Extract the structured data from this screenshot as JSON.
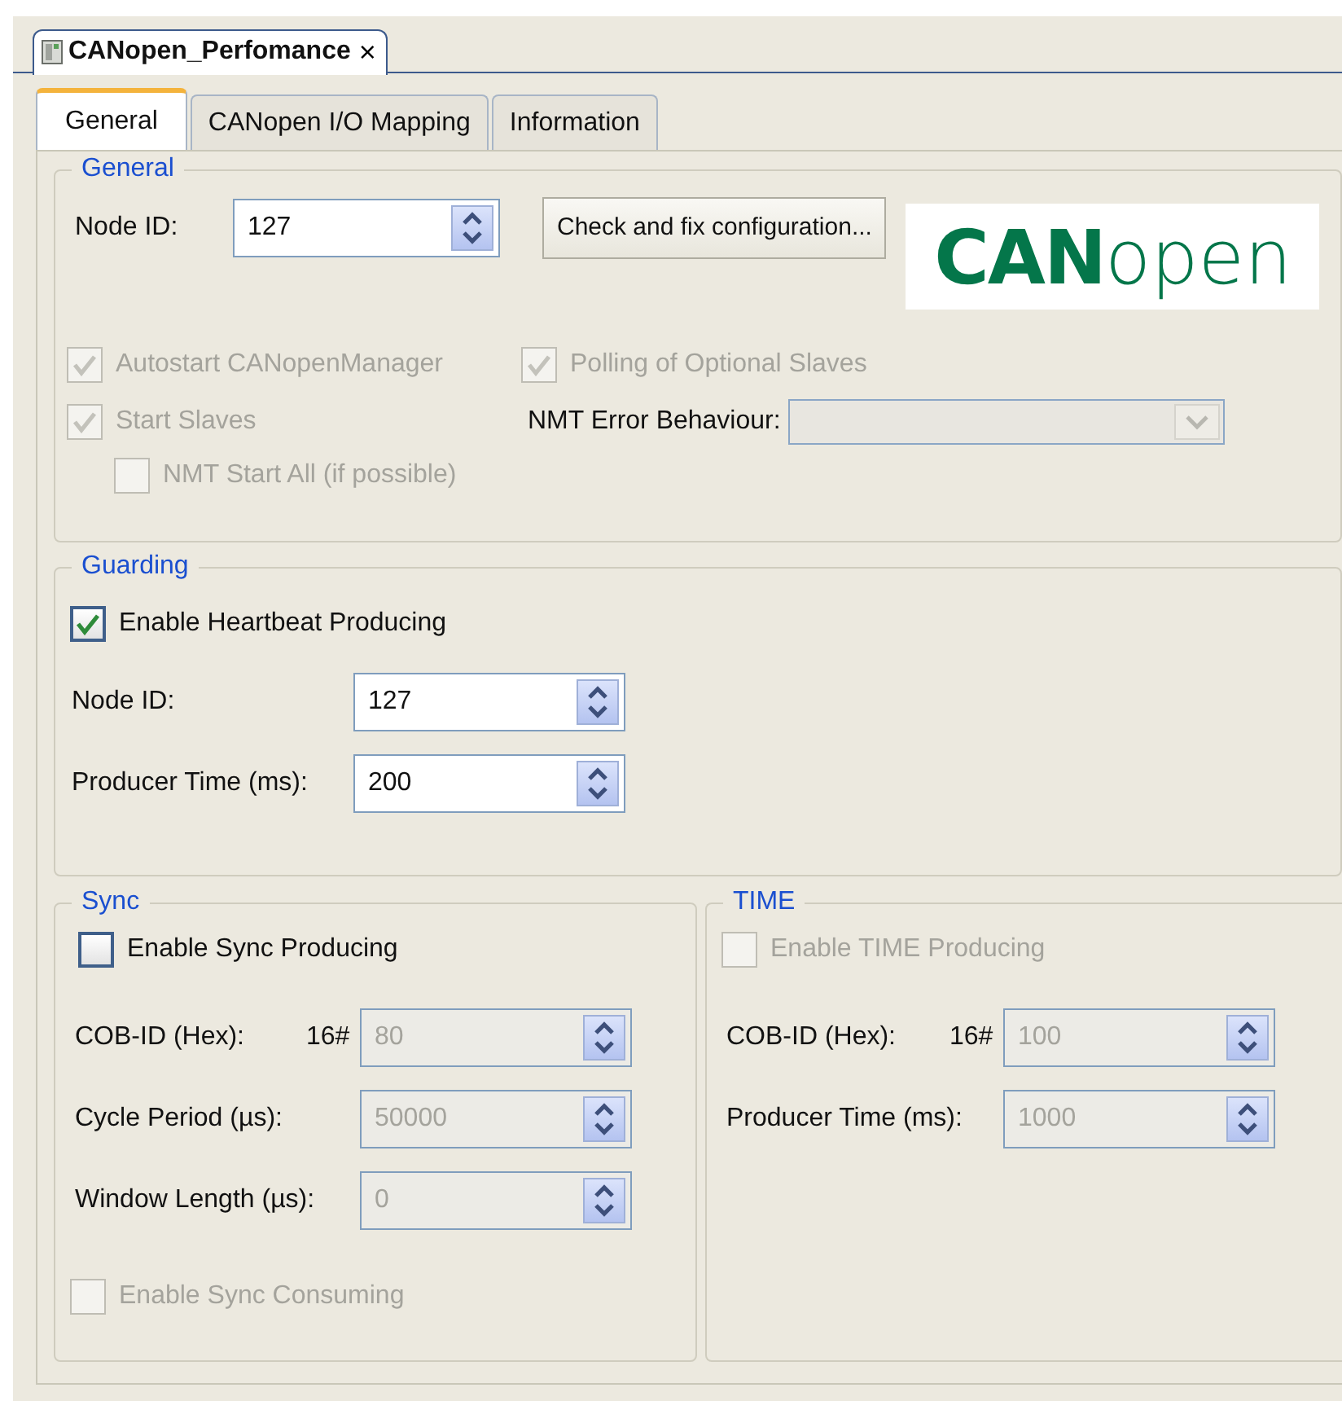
{
  "editor_tab": {
    "title": "CANopen_Perfomance",
    "close": "×"
  },
  "tabs": [
    {
      "label": "General",
      "selected": true
    },
    {
      "label": "CANopen I/O Mapping",
      "selected": false
    },
    {
      "label": "Information",
      "selected": false
    }
  ],
  "general": {
    "title": "General",
    "node_id": {
      "label": "Node ID:",
      "value": "127",
      "disabled": false
    },
    "check_button": "Check and fix configuration...",
    "logo": {
      "bold": "CAN",
      "light": "open"
    },
    "autostart": {
      "label": "Autostart CANopenManager",
      "checked": true,
      "disabled": true
    },
    "polling": {
      "label": "Polling of Optional Slaves",
      "checked": true,
      "disabled": true
    },
    "start_slaves": {
      "label": "Start Slaves",
      "checked": true,
      "disabled": true
    },
    "nmt_error": {
      "label": "NMT Error Behaviour:",
      "disabled": true
    },
    "nmt_start_all": {
      "label": "NMT Start All (if possible)",
      "checked": false,
      "disabled": true
    }
  },
  "guarding": {
    "title": "Guarding",
    "heartbeat": {
      "label": "Enable Heartbeat Producing",
      "checked": true,
      "disabled": false
    },
    "fields": [
      {
        "label": "Node ID:",
        "value": "127",
        "disabled": false
      },
      {
        "label": "Producer Time (ms):",
        "value": "200",
        "disabled": false
      }
    ]
  },
  "sync": {
    "title": "Sync",
    "producing": {
      "label": "Enable Sync Producing",
      "checked": false,
      "disabled": false
    },
    "fields": [
      {
        "label": "COB-ID (Hex):",
        "prefix": "16#",
        "value": "80",
        "disabled": true
      },
      {
        "label": "Cycle Period (µs):",
        "value": "50000",
        "disabled": true
      },
      {
        "label": "Window Length (µs):",
        "value": "0",
        "disabled": true
      }
    ],
    "consuming": {
      "label": "Enable Sync Consuming",
      "checked": false,
      "disabled": true
    }
  },
  "time": {
    "title": "TIME",
    "producing": {
      "label": "Enable TIME Producing",
      "checked": false,
      "disabled": true
    },
    "fields": [
      {
        "label": "COB-ID (Hex):",
        "prefix": "16#",
        "value": "100",
        "disabled": true
      },
      {
        "label": "Producer Time (ms):",
        "value": "1000",
        "disabled": true
      }
    ]
  }
}
